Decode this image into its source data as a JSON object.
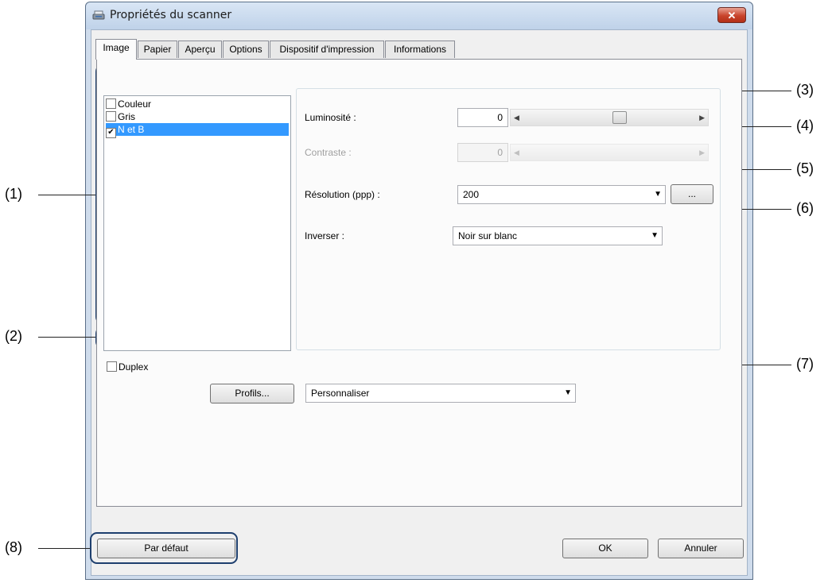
{
  "window": {
    "title": "Propriétés du scanner",
    "close_label": "✕"
  },
  "tabs": [
    {
      "label": "Image",
      "active": true
    },
    {
      "label": "Papier"
    },
    {
      "label": "Aperçu"
    },
    {
      "label": "Options"
    },
    {
      "label": "Dispositif d'impression"
    },
    {
      "label": "Informations"
    }
  ],
  "image_modes": [
    {
      "label": "Couleur",
      "checked": false
    },
    {
      "label": "Gris",
      "checked": false
    },
    {
      "label": "N et B",
      "checked": true,
      "selected": true
    }
  ],
  "settings": {
    "brightness_label": "Luminosité :",
    "brightness_value": "0",
    "contrast_label": "Contraste :",
    "contrast_value": "0",
    "resolution_label": "Résolution (ppp) :",
    "resolution_value": "200",
    "resolution_more": "...",
    "invert_label": "Inverser :",
    "invert_value": "Noir sur blanc"
  },
  "duplex_label": "Duplex",
  "profiles": {
    "button_label": "Profils...",
    "value": "Personnaliser"
  },
  "footer": {
    "default_label": "Par défaut",
    "ok_label": "OK",
    "cancel_label": "Annuler"
  },
  "callouts": [
    "(1)",
    "(2)",
    "(3)",
    "(4)",
    "(5)",
    "(6)",
    "(7)",
    "(8)"
  ],
  "colors": {
    "callout_border": "#1e3f6e",
    "selection": "#3399ff",
    "close_button": "#c8432b"
  }
}
